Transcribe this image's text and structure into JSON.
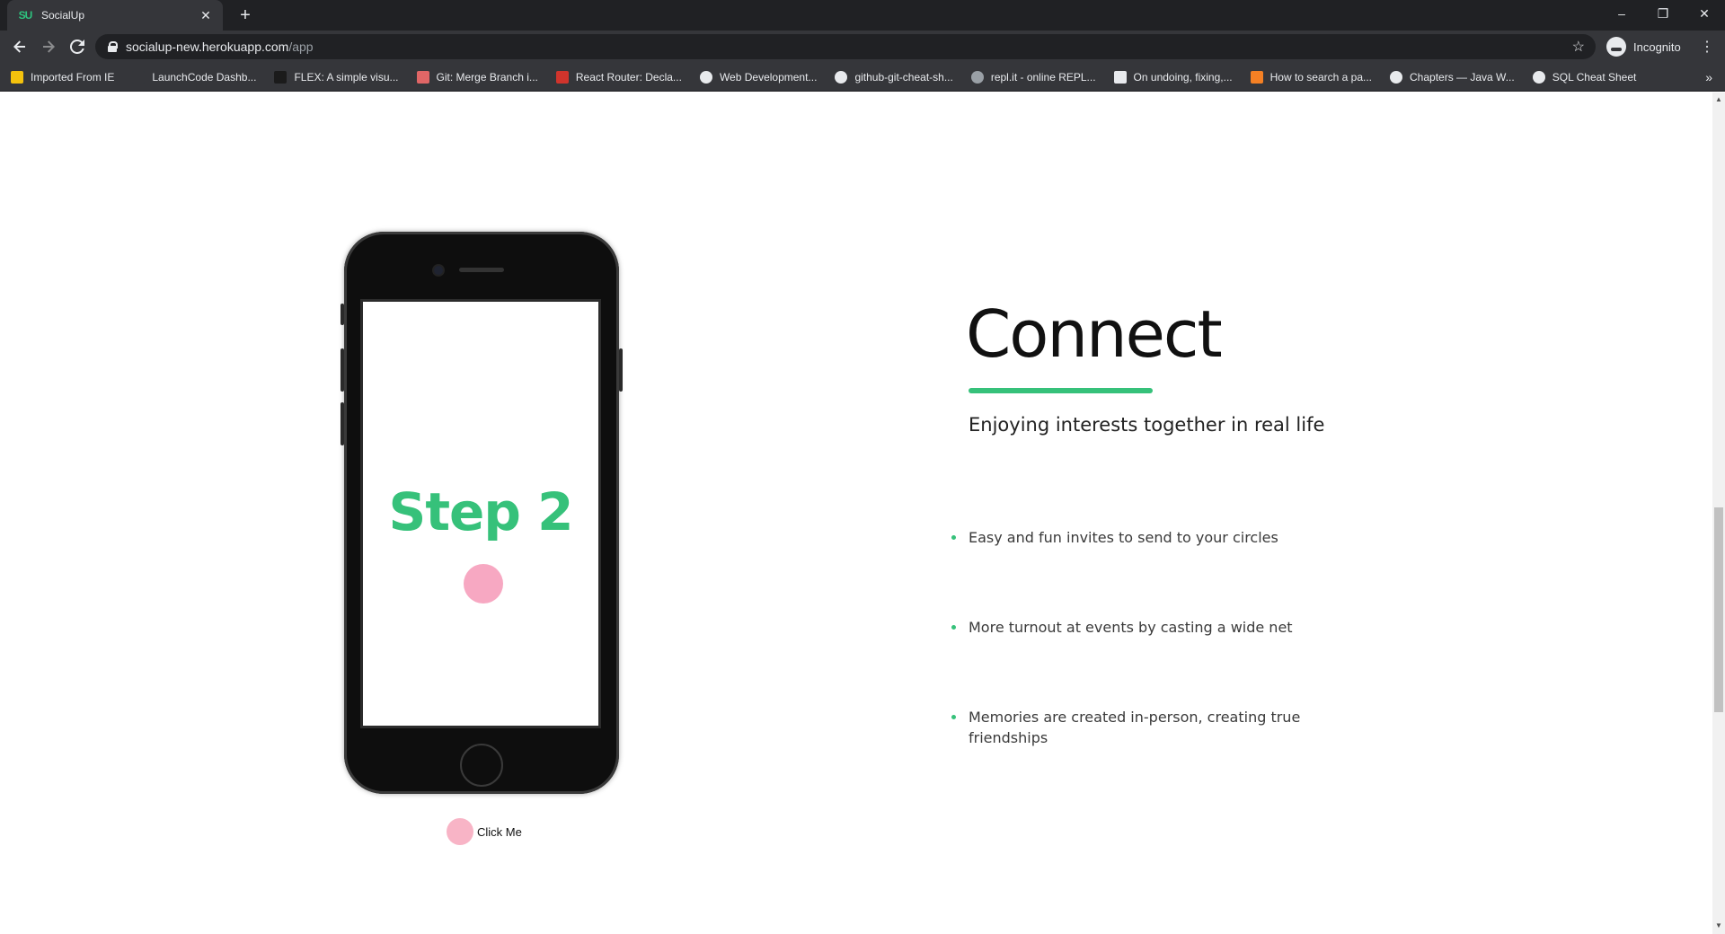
{
  "browser": {
    "tab_title": "SocialUp",
    "tab_favicon": "SU",
    "new_tab_label": "+",
    "url_host": "socialup-new.herokuapp.com",
    "url_path": "/app",
    "profile_label": "Incognito",
    "window_controls": {
      "minimize": "–",
      "restore": "❐",
      "close": "✕"
    },
    "bookmarks": [
      {
        "label": "Imported From IE",
        "icon": "folder-icon",
        "color": "#f4c20d"
      },
      {
        "label": "LaunchCode Dashb...",
        "icon": "launchcode-icon",
        "color": "#35363a"
      },
      {
        "label": "FLEX: A simple visu...",
        "icon": "flex-icon",
        "color": "#1b1b1b"
      },
      {
        "label": "Git: Merge Branch i...",
        "icon": "sa-icon",
        "color": "#e06666"
      },
      {
        "label": "React Router: Decla...",
        "icon": "react-router-icon",
        "color": "#d0342c"
      },
      {
        "label": "Web Development...",
        "icon": "b-icon",
        "color": "#e8eaed"
      },
      {
        "label": "github-git-cheat-sh...",
        "icon": "globe-icon",
        "color": "#e8eaed"
      },
      {
        "label": "repl.it - online REPL...",
        "icon": "replit-icon",
        "color": "#9aa0a6"
      },
      {
        "label": "On undoing, fixing,...",
        "icon": "atlassian-icon",
        "color": "#e8eaed"
      },
      {
        "label": "How to search a pa...",
        "icon": "stackoverflow-icon",
        "color": "#f48024"
      },
      {
        "label": "Chapters — Java W...",
        "icon": "globe-icon",
        "color": "#e8eaed"
      },
      {
        "label": "SQL Cheat Sheet",
        "icon": "globe-icon",
        "color": "#e8eaed"
      }
    ],
    "bookmarks_overflow": "»"
  },
  "main": {
    "phone": {
      "screen_text": "Step 2"
    },
    "click_button_label": "Click Me",
    "heading": "Connect",
    "subheading": "Enjoying interests together in real life",
    "features": [
      "Easy and fun invites to send to your circles",
      "More turnout at events by casting a wide net",
      "Memories are created in-person, creating true friendships"
    ],
    "colors": {
      "accent_green": "#36c17a",
      "dot_pink": "#f7a8c2"
    }
  }
}
